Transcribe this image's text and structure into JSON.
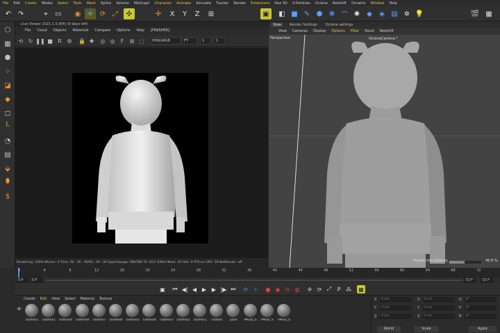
{
  "menubar": {
    "items": [
      "File",
      "Edit",
      "Create",
      "Modes",
      "Select",
      "Tools",
      "Mesh",
      "Spline",
      "Volume",
      "MoGraph",
      "Character",
      "Animate",
      "Simulate",
      "Tracker",
      "Render",
      "Extensions",
      "Dax 3D",
      "X-Particles",
      "Octane",
      "Redshift",
      "Ornatrix",
      "Window",
      "Help"
    ],
    "highlighted": [
      "File",
      "Create",
      "Select",
      "Tools",
      "Mesh",
      "Character",
      "Animate",
      "Extensions",
      "Window"
    ]
  },
  "live_viewer": {
    "title": "Live Viewer 2021.1.5-[R4] (9 days left)",
    "menu": [
      "File",
      "Cloud",
      "Objects",
      "Materials",
      "Compare",
      "Options",
      "Help",
      "[FINISHED]"
    ],
    "color_space": "HDR/sRGB",
    "mode": "FT",
    "num1": "1",
    "num2": "1",
    "status": "Rendering: 100%  Ms/sec: 0   Time: 00 : 00 : 00/00 : 00 : 00  Spp/maxspp: 580/580   Tri: 0/11.836m   Mesh: 19   Hair: 0   RTX:on     GPU:     58     NetRender: off"
  },
  "viewport": {
    "tabs": [
      "View",
      "Render Settings",
      "Octane settings"
    ],
    "active_tab": "View",
    "menu": [
      "View",
      "Cameras",
      "Display",
      "Options",
      "Filter",
      "Panel",
      "Redshift"
    ],
    "highlighted": [
      "Options",
      "Filter"
    ],
    "perspective_label": "Perspective",
    "camera_label": "OctaneCamera.*",
    "opacity_label": "Perspective.Opacity",
    "opacity_value": "46.8 %"
  },
  "timeline": {
    "ticks": [
      "0",
      "4",
      "8",
      "12",
      "16",
      "20",
      "24",
      "28",
      "32",
      "36",
      "40",
      "44",
      "48",
      "52",
      "56",
      "60",
      "64",
      "68",
      "72"
    ],
    "start_frame": "0 F",
    "start_frame2": "0 F",
    "end_frame": "72 F",
    "end_frame2": "72 F"
  },
  "materials": {
    "menu": [
      "Create",
      "Edit",
      "View",
      "Select",
      "Material",
      "Texture"
    ],
    "highlighted": [
      "Edit"
    ],
    "items": [
      "clothes1",
      "clothes1",
      "clothes9",
      "clothes8",
      "clothes7",
      "clothes6",
      "clothes5",
      "clothes4",
      "clothes3",
      "clothes2",
      "clothes1",
      "clothes",
      "pose",
      "PM3D_S",
      "PM3D_S",
      "PM3D_S"
    ]
  },
  "attributes": {
    "rows": [
      {
        "axis": "X",
        "value": "0 cm",
        "axis2": "X",
        "value2": "0 cm",
        "axis3": "H",
        "value3": "0°"
      },
      {
        "axis": "Y",
        "value": "0 cm",
        "axis2": "Y",
        "value2": "0 cm",
        "axis3": "P",
        "value3": "0°"
      },
      {
        "axis": "Z",
        "value": "0 cm",
        "axis2": "Z",
        "value2": "0 cm",
        "axis3": "B",
        "value3": "0°"
      }
    ],
    "mode_select": "World",
    "scale_select": "Scale",
    "apply_label": "Apply"
  },
  "colors": {
    "accent_yellow": "#c8c832",
    "accent_blue": "#5aa0ff",
    "accent_orange": "#f09030",
    "timeline_cursor": "#4090ff"
  }
}
